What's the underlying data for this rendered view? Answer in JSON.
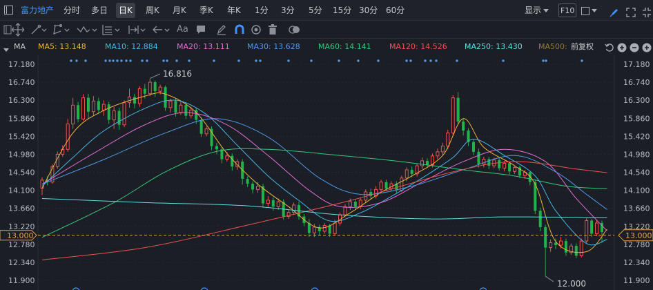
{
  "stock_name": "富力地产",
  "periods": [
    "分时",
    "多日",
    "日K",
    "周K",
    "月K",
    "季K",
    "年K",
    "1分",
    "3分",
    "5分",
    "15分",
    "30分",
    "60分"
  ],
  "active_period": "日K",
  "display_label": "显示",
  "f10_label": "F10",
  "text_tool_label": "Aa",
  "ma": {
    "label": "MA",
    "items": [
      {
        "label": "MA5: 13.148",
        "color": "#f0b23a"
      },
      {
        "label": "MA10: 12.884",
        "color": "#47b7ea"
      },
      {
        "label": "MA20: 13.111",
        "color": "#e06cd8"
      },
      {
        "label": "MA30: 13.628",
        "color": "#4f98ea"
      },
      {
        "label": "MA60: 14.141",
        "color": "#36c77e"
      },
      {
        "label": "MA120: 14.526",
        "color": "#ef5350"
      },
      {
        "label": "MA250: 13.430",
        "color": "#5de0e6"
      },
      {
        "label": "MA500:",
        "color": "#8f7a3c"
      }
    ],
    "adjust_label": "前复权"
  },
  "icons": [
    "crosshair-icon",
    "line-tool-icon",
    "polyline-tool-icon",
    "wave-tool-icon",
    "fib-tool-icon",
    "range-tool-icon",
    "arrow-tool-icon",
    "text-tool-icon",
    "note-tool-icon",
    "pen-icon",
    "magnet-icon",
    "eye-icon",
    "trash-icon",
    "toggle-icon"
  ],
  "colors": {
    "up": "#ef5350",
    "down": "#22b24c",
    "accent": "#3e93ff",
    "current_price": "#e8a24a"
  },
  "chart_data": {
    "type": "candlestick",
    "y_ticks": [
      "17.180",
      "16.740",
      "16.300",
      "15.860",
      "15.420",
      "14.980",
      "14.540",
      "14.100",
      "13.660",
      "13.220",
      "12.780",
      "12.340",
      "11.900"
    ],
    "ylim": [
      11.9,
      17.18
    ],
    "current_price": "13.000",
    "high_label": "16.816",
    "low_label": "12.000",
    "high_value": 16.816,
    "low_value": 12.0,
    "candles": [
      [
        14.15,
        14.35,
        13.98,
        14.42
      ],
      [
        14.35,
        14.3,
        14.22,
        14.44
      ],
      [
        14.3,
        14.68,
        14.26,
        14.74
      ],
      [
        14.68,
        14.98,
        14.62,
        15.05
      ],
      [
        14.98,
        15.1,
        14.92,
        15.2
      ],
      [
        15.1,
        15.72,
        15.04,
        15.84
      ],
      [
        15.72,
        16.18,
        15.6,
        16.36
      ],
      [
        16.18,
        15.84,
        15.76,
        16.26
      ],
      [
        15.84,
        16.36,
        15.8,
        16.45
      ],
      [
        16.36,
        16.02,
        15.86,
        16.46
      ],
      [
        16.02,
        16.28,
        15.92,
        16.4
      ],
      [
        16.28,
        16.06,
        15.96,
        16.36
      ],
      [
        16.06,
        16.2,
        15.92,
        16.3
      ],
      [
        16.2,
        15.82,
        15.72,
        16.26
      ],
      [
        15.82,
        16.04,
        15.6,
        16.14
      ],
      [
        16.04,
        15.7,
        15.58,
        16.12
      ],
      [
        15.7,
        16.24,
        15.64,
        16.3
      ],
      [
        16.24,
        16.38,
        16.12,
        16.58
      ],
      [
        16.38,
        16.22,
        16.1,
        16.46
      ],
      [
        16.22,
        16.58,
        16.14,
        16.64
      ],
      [
        16.58,
        16.46,
        16.34,
        16.7
      ],
      [
        16.46,
        16.74,
        16.4,
        16.82
      ],
      [
        16.74,
        16.52,
        16.38,
        16.78
      ],
      [
        16.52,
        16.62,
        16.44,
        16.68
      ],
      [
        16.62,
        16.12,
        16.04,
        16.66
      ],
      [
        16.12,
        16.28,
        16.0,
        16.34
      ],
      [
        16.28,
        16.0,
        15.9,
        16.34
      ],
      [
        16.0,
        16.18,
        15.94,
        16.28
      ],
      [
        16.18,
        15.92,
        15.84,
        16.24
      ],
      [
        15.92,
        16.06,
        15.86,
        16.14
      ],
      [
        16.06,
        15.82,
        15.72,
        16.12
      ],
      [
        15.82,
        15.48,
        15.4,
        15.88
      ],
      [
        15.48,
        15.6,
        15.42,
        15.66
      ],
      [
        15.6,
        15.18,
        15.08,
        15.66
      ],
      [
        15.18,
        15.1,
        14.98,
        15.26
      ],
      [
        15.1,
        14.86,
        14.76,
        15.16
      ],
      [
        14.86,
        14.94,
        14.8,
        15.04
      ],
      [
        14.94,
        14.68,
        14.58,
        15.0
      ],
      [
        14.68,
        14.8,
        14.6,
        14.86
      ],
      [
        14.8,
        14.38,
        14.24,
        14.86
      ],
      [
        14.38,
        14.26,
        14.18,
        14.44
      ],
      [
        14.26,
        14.12,
        14.02,
        14.32
      ],
      [
        14.12,
        14.2,
        14.04,
        14.3
      ],
      [
        14.2,
        13.78,
        13.68,
        14.26
      ],
      [
        13.78,
        13.86,
        13.7,
        13.96
      ],
      [
        13.86,
        13.7,
        13.6,
        13.92
      ],
      [
        13.7,
        13.82,
        13.62,
        13.9
      ],
      [
        13.82,
        13.46,
        13.38,
        13.88
      ],
      [
        13.46,
        13.56,
        13.4,
        13.62
      ],
      [
        13.56,
        13.74,
        13.5,
        13.8
      ],
      [
        13.74,
        13.46,
        13.38,
        13.82
      ],
      [
        13.46,
        13.3,
        13.22,
        13.52
      ],
      [
        13.3,
        13.06,
        12.96,
        13.4
      ],
      [
        13.06,
        13.2,
        12.96,
        13.28
      ],
      [
        13.2,
        13.1,
        13.0,
        13.26
      ],
      [
        13.1,
        13.24,
        13.04,
        13.3
      ],
      [
        13.24,
        13.04,
        12.96,
        13.28
      ],
      [
        13.04,
        13.3,
        13.0,
        13.38
      ],
      [
        13.3,
        13.5,
        13.24,
        13.56
      ],
      [
        13.5,
        13.7,
        13.44,
        13.76
      ],
      [
        13.7,
        13.82,
        13.62,
        13.9
      ],
      [
        13.82,
        13.7,
        13.62,
        13.88
      ],
      [
        13.7,
        13.86,
        13.64,
        13.92
      ],
      [
        13.86,
        14.06,
        13.8,
        14.12
      ],
      [
        14.06,
        13.96,
        13.88,
        14.14
      ],
      [
        13.96,
        14.12,
        13.9,
        14.2
      ],
      [
        14.12,
        14.3,
        14.04,
        14.36
      ],
      [
        14.3,
        14.14,
        14.08,
        14.36
      ],
      [
        14.14,
        14.26,
        14.08,
        14.32
      ],
      [
        14.26,
        14.1,
        14.02,
        14.32
      ],
      [
        14.1,
        14.4,
        14.06,
        14.46
      ],
      [
        14.4,
        14.6,
        14.32,
        14.66
      ],
      [
        14.6,
        14.5,
        14.42,
        14.68
      ],
      [
        14.5,
        14.7,
        14.44,
        14.76
      ],
      [
        14.7,
        14.82,
        14.62,
        14.9
      ],
      [
        14.82,
        14.72,
        14.64,
        14.88
      ],
      [
        14.72,
        14.94,
        14.66,
        15.0
      ],
      [
        14.94,
        15.04,
        14.86,
        15.12
      ],
      [
        15.04,
        15.18,
        14.96,
        15.26
      ],
      [
        15.18,
        15.5,
        15.1,
        15.58
      ],
      [
        15.5,
        16.36,
        15.44,
        16.42
      ],
      [
        16.36,
        15.78,
        15.7,
        16.5
      ],
      [
        15.78,
        15.56,
        15.44,
        15.86
      ],
      [
        15.56,
        15.28,
        15.18,
        15.62
      ],
      [
        15.28,
        15.04,
        14.96,
        15.34
      ],
      [
        15.04,
        14.74,
        14.66,
        15.12
      ],
      [
        14.74,
        14.86,
        14.66,
        14.92
      ],
      [
        14.86,
        14.7,
        14.62,
        14.92
      ],
      [
        14.7,
        14.84,
        14.64,
        14.9
      ],
      [
        14.84,
        14.64,
        14.58,
        14.9
      ],
      [
        14.64,
        14.76,
        14.56,
        14.82
      ],
      [
        14.76,
        14.56,
        14.48,
        14.8
      ],
      [
        14.56,
        14.66,
        14.5,
        14.7
      ],
      [
        14.66,
        14.46,
        14.4,
        14.7
      ],
      [
        14.46,
        14.54,
        14.38,
        14.6
      ],
      [
        14.54,
        14.3,
        14.22,
        14.58
      ],
      [
        14.3,
        13.6,
        13.52,
        14.36
      ],
      [
        13.6,
        13.2,
        13.1,
        13.68
      ],
      [
        13.2,
        12.7,
        12.0,
        13.26
      ],
      [
        12.7,
        12.82,
        12.6,
        12.9
      ],
      [
        12.82,
        12.76,
        12.66,
        12.92
      ],
      [
        12.76,
        12.86,
        12.68,
        12.96
      ],
      [
        12.86,
        12.58,
        12.5,
        12.92
      ],
      [
        12.58,
        12.74,
        12.52,
        12.8
      ],
      [
        12.74,
        12.5,
        12.44,
        12.8
      ],
      [
        12.5,
        12.86,
        12.46,
        12.92
      ],
      [
        12.86,
        13.36,
        12.8,
        13.42
      ],
      [
        13.36,
        13.04,
        12.96,
        13.4
      ],
      [
        13.04,
        13.3,
        12.98,
        13.38
      ],
      [
        13.3,
        13.08,
        12.82,
        13.36
      ]
    ],
    "ma_series": [
      {
        "name": "MA5",
        "color": "#f0b23a",
        "values": [
          [
            0,
            14.15
          ],
          [
            6,
            15.5
          ],
          [
            12,
            16.05
          ],
          [
            20,
            16.4
          ],
          [
            24,
            16.45
          ],
          [
            30,
            16.0
          ],
          [
            36,
            15.0
          ],
          [
            42,
            14.25
          ],
          [
            48,
            13.7
          ],
          [
            54,
            13.18
          ],
          [
            60,
            13.55
          ],
          [
            66,
            14.05
          ],
          [
            72,
            14.45
          ],
          [
            78,
            14.95
          ],
          [
            82,
            15.85
          ],
          [
            86,
            15.15
          ],
          [
            92,
            14.7
          ],
          [
            96,
            14.25
          ],
          [
            100,
            12.85
          ],
          [
            106,
            12.6
          ],
          [
            110,
            13.15
          ]
        ]
      },
      {
        "name": "MA10",
        "color": "#47b7ea",
        "values": [
          [
            0,
            14.2
          ],
          [
            6,
            14.9
          ],
          [
            12,
            15.55
          ],
          [
            20,
            16.1
          ],
          [
            26,
            16.3
          ],
          [
            32,
            15.95
          ],
          [
            38,
            15.2
          ],
          [
            44,
            14.45
          ],
          [
            50,
            13.85
          ],
          [
            56,
            13.35
          ],
          [
            62,
            13.55
          ],
          [
            68,
            13.95
          ],
          [
            74,
            14.4
          ],
          [
            80,
            14.9
          ],
          [
            84,
            15.35
          ],
          [
            90,
            14.95
          ],
          [
            96,
            14.45
          ],
          [
            100,
            13.6
          ],
          [
            106,
            12.8
          ],
          [
            110,
            12.9
          ]
        ]
      },
      {
        "name": "MA20",
        "color": "#e06cd8",
        "values": [
          [
            0,
            14.25
          ],
          [
            10,
            15.0
          ],
          [
            20,
            15.7
          ],
          [
            28,
            16.0
          ],
          [
            36,
            15.7
          ],
          [
            44,
            14.95
          ],
          [
            52,
            14.1
          ],
          [
            58,
            13.7
          ],
          [
            66,
            13.8
          ],
          [
            74,
            14.3
          ],
          [
            82,
            14.8
          ],
          [
            90,
            15.1
          ],
          [
            98,
            14.8
          ],
          [
            104,
            13.9
          ],
          [
            110,
            13.11
          ]
        ]
      },
      {
        "name": "MA30",
        "color": "#4f98ea",
        "values": [
          [
            0,
            14.25
          ],
          [
            12,
            14.85
          ],
          [
            24,
            15.5
          ],
          [
            34,
            15.85
          ],
          [
            44,
            15.4
          ],
          [
            54,
            14.4
          ],
          [
            62,
            14.0
          ],
          [
            72,
            14.2
          ],
          [
            82,
            14.6
          ],
          [
            92,
            14.95
          ],
          [
            100,
            14.55
          ],
          [
            106,
            14.0
          ],
          [
            110,
            13.63
          ]
        ]
      },
      {
        "name": "MA60",
        "color": "#36c77e",
        "values": [
          [
            0,
            12.95
          ],
          [
            14,
            13.8
          ],
          [
            24,
            14.55
          ],
          [
            34,
            15.05
          ],
          [
            44,
            15.1
          ],
          [
            58,
            14.95
          ],
          [
            70,
            14.8
          ],
          [
            82,
            14.6
          ],
          [
            92,
            14.45
          ],
          [
            102,
            14.2
          ],
          [
            110,
            14.14
          ]
        ]
      },
      {
        "name": "MA120",
        "color": "#ef5350",
        "values": [
          [
            0,
            12.4
          ],
          [
            20,
            12.7
          ],
          [
            40,
            13.25
          ],
          [
            60,
            13.85
          ],
          [
            80,
            14.55
          ],
          [
            92,
            14.8
          ],
          [
            104,
            14.62
          ],
          [
            110,
            14.53
          ]
        ]
      },
      {
        "name": "MA250",
        "color": "#5de0e6",
        "values": [
          [
            0,
            13.9
          ],
          [
            20,
            13.8
          ],
          [
            40,
            13.72
          ],
          [
            58,
            13.5
          ],
          [
            76,
            13.4
          ],
          [
            90,
            13.45
          ],
          [
            110,
            13.43
          ]
        ]
      }
    ]
  }
}
